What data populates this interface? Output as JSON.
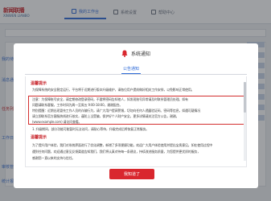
{
  "app": {
    "logo_text": "新闻联播",
    "logo_sub": "XINWEN LIANBO",
    "nav_tabs": [
      {
        "label": "我的工作台",
        "active": true
      },
      {
        "label": "系统设置",
        "active": false
      },
      {
        "label": "帮助中心",
        "active": false
      }
    ],
    "side_links": [
      "我的待办",
      "消息通知",
      "任务列表",
      "工作日志",
      "审核管理",
      "统计报表"
    ]
  },
  "modal": {
    "title": "系统通知",
    "tab_label": "公告通知",
    "section1_title": "温馨提示",
    "section1_paragraphs": [
      "为保障系统的安全稳定运行，平台将于近期进行版本升级维护，请各位用户提前做好相关工作安排，以免影响正常使用。",
      "1. 升级期间，部分功能可能暂时无法访问，请耐心等待，升级完成后将恢复正常服务。",
      "2. 请勿在升级期间提交重要数据，如有未保存内容请及时保存，避免数据丢失造成不必要的损失，感谢您的理解与配合。"
    ],
    "notice_lines": [
      "注意：为保障账号安全，请定期修改登录密码，不要将密码告知他人，如发现账号异常请及时联系管理员处理。如有",
      "问题请联系客服，工作时间为周一至周五 9:00-18:00，谢谢配合。",
      "特别提醒：近期出现冒充工作人员的诈骗行为，请广大用户提高警惕，切勿向任何人透露验证码、密码等信息，如遇可疑情况",
      "请立即联系官方客服热线进行核实，谨防上当受骗，保护好个人财产安全。更多详情请关注官方公告，谢谢。",
      "(www.example.com) 请访问查看。"
    ],
    "section2_title": "温馨提示",
    "section2_paragraphs": [
      "为了提升用户体验，我们对系统界面进行了优化调整，新增了多项便捷功能，欢迎广大用户体验使用并提出宝贵意见。如在使用过程中",
      "遇到任何问题，欢迎通过意见反馈渠道告知我们，我们将认真对待每一条建议，持续改进服务质量，为您提供更优质的服务，",
      "感谢您一直以来的支持与信任。"
    ],
    "ack_button": "我知道了"
  },
  "colors": {
    "accent_red": "#d9272e",
    "link_blue": "#2f6bd8"
  }
}
